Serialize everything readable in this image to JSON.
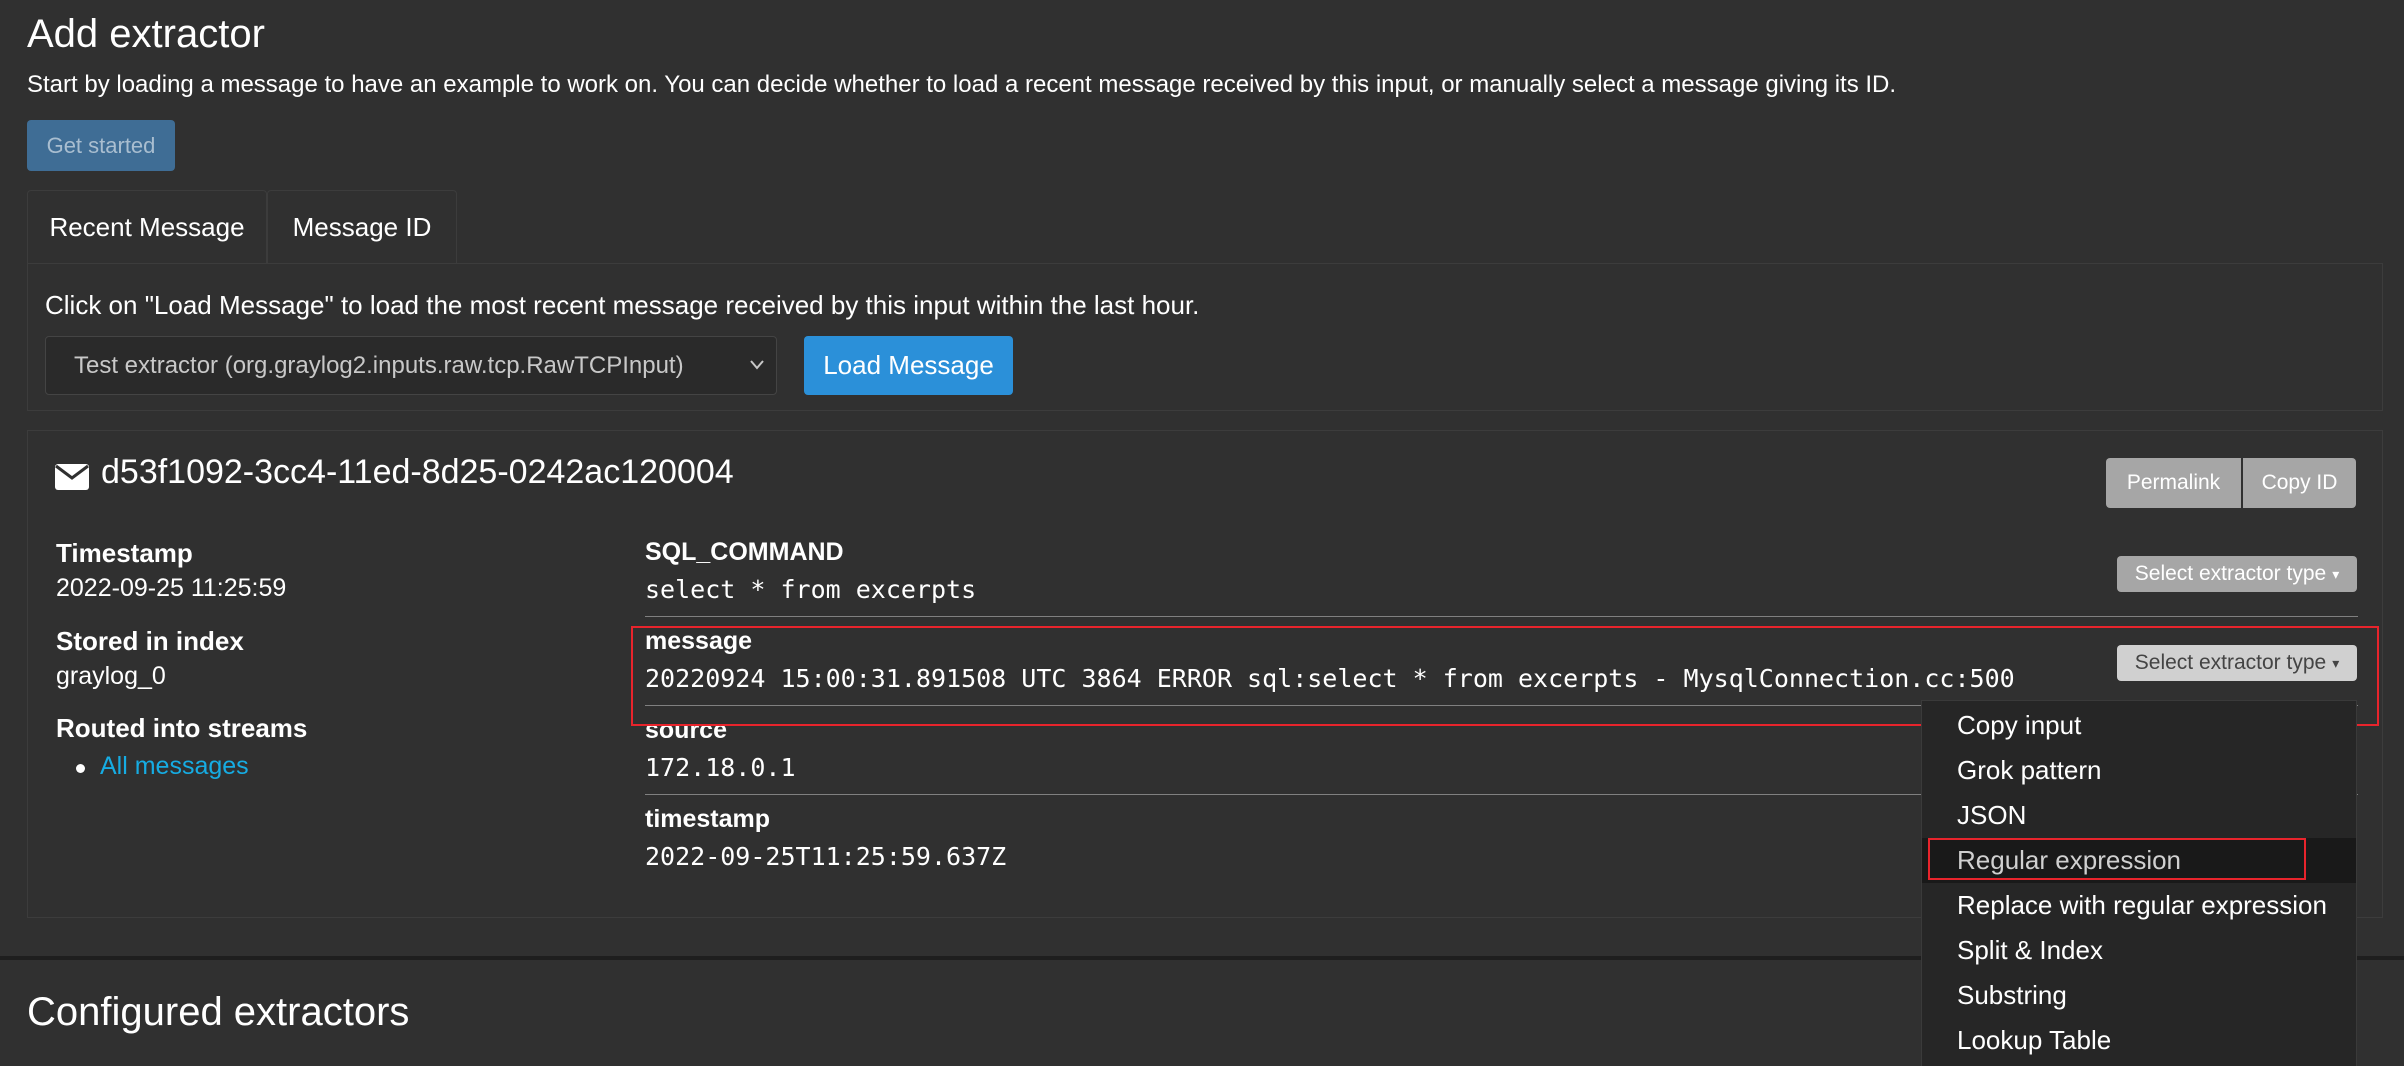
{
  "header": {
    "title": "Add extractor",
    "description": "Start by loading a message to have an example to work on. You can decide whether to load a recent message received by this input, or manually select a message giving its ID.",
    "get_started_label": "Get started"
  },
  "tabs": [
    {
      "label": "Recent Message",
      "active": true
    },
    {
      "label": "Message ID",
      "active": false
    }
  ],
  "recent_pane": {
    "instruction": "Click on \"Load Message\" to load the most recent message received by this input within the last hour.",
    "input_select_value": "Test extractor (org.graylog2.inputs.raw.tcp.RawTCPInput)",
    "load_button_label": "Load Message"
  },
  "message": {
    "id": "d53f1092-3cc4-11ed-8d25-0242ac120004",
    "icon": "envelope-icon",
    "permalink_label": "Permalink",
    "copy_id_label": "Copy ID",
    "meta": {
      "timestamp_label": "Timestamp",
      "timestamp_value": "2022-09-25 11:25:59",
      "index_label": "Stored in index",
      "index_value": "graylog_0",
      "streams_label": "Routed into streams",
      "streams": [
        "All messages"
      ]
    },
    "fields": [
      {
        "name": "SQL_COMMAND",
        "value": "select * from excerpts"
      },
      {
        "name": "message",
        "value": "20220924 15:00:31.891508 UTC 3864 ERROR sql:select * from excerpts - MysqlConnection.cc:500"
      },
      {
        "name": "source",
        "value": "172.18.0.1"
      },
      {
        "name": "timestamp",
        "value": "2022-09-25T11:25:59.637Z"
      }
    ],
    "select_extractor_label": "Select extractor type"
  },
  "extractor_menu": {
    "items": [
      "Copy input",
      "Grok pattern",
      "JSON",
      "Regular expression",
      "Replace with regular expression",
      "Split & Index",
      "Substring",
      "Lookup Table"
    ],
    "highlighted": "Regular expression"
  },
  "configured": {
    "title": "Configured extractors"
  },
  "colors": {
    "accent": "#2b90d9",
    "stream_link": "#16ace3",
    "highlight_border": "#e8242c",
    "background": "#303030"
  }
}
